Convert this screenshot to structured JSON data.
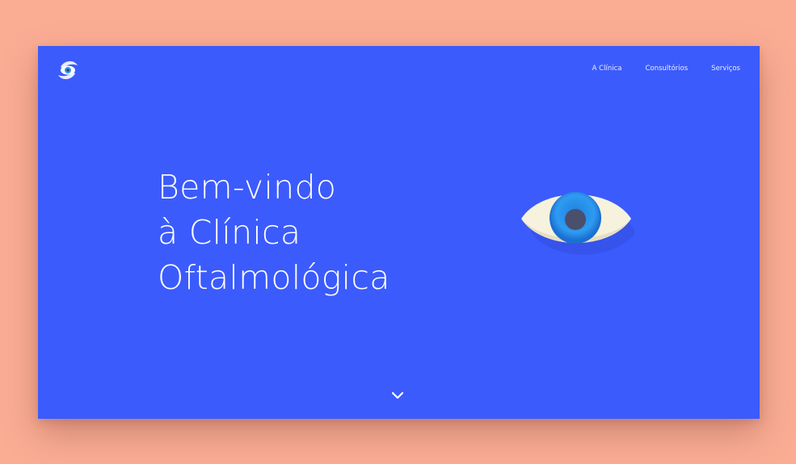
{
  "nav": {
    "items": [
      {
        "label": "A Clínica"
      },
      {
        "label": "Consultórios"
      },
      {
        "label": "Serviços"
      }
    ]
  },
  "hero": {
    "title_lines": [
      "Bem-vindo",
      "à Clínica",
      "Oftalmológica"
    ]
  },
  "icons": {
    "logo": "eye-logo-icon",
    "hero_image": "eye-illustration",
    "scroll": "chevron-down-icon"
  },
  "colors": {
    "page_background": "#FBAD94",
    "hero_background": "#3B5BFD",
    "text": "#FFFFFF",
    "iris": "#2E9BF0",
    "pupil": "#4A4F6B",
    "sclera": "#F6F2DD"
  }
}
